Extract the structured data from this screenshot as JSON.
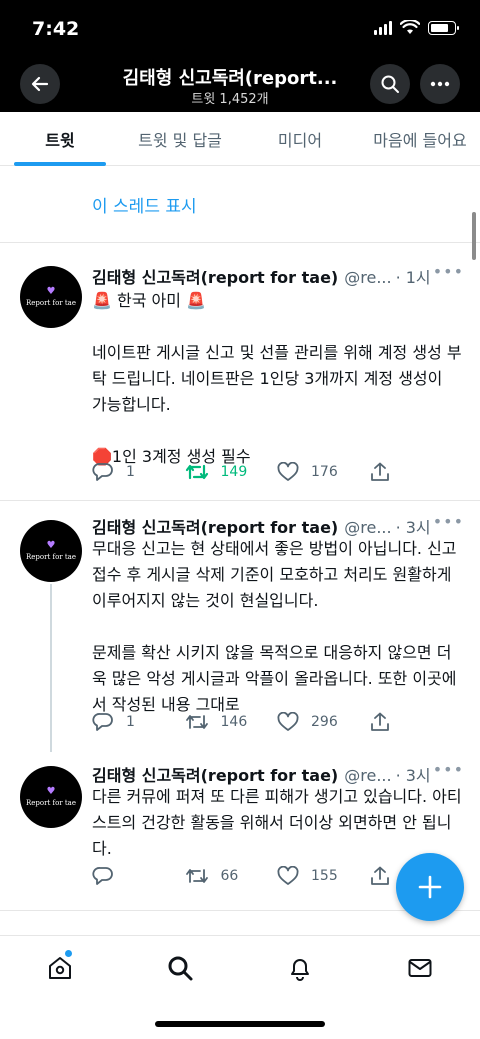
{
  "status_bar": {
    "time": "7:42"
  },
  "header": {
    "title": "김태형 신고독려(report...",
    "subtitle": "트윗 1,452개"
  },
  "tabs": [
    {
      "label": "트윗",
      "active": true
    },
    {
      "label": "트윗 및 답글",
      "active": false
    },
    {
      "label": "미디어",
      "active": false
    },
    {
      "label": "마음에 들어요",
      "active": false
    }
  ],
  "show_thread": "이 스레드 표시",
  "avatar_text": "Report for tae",
  "tweets": [
    {
      "name": "김태형 신고독려(report for tae)",
      "handle": "@re...",
      "time": "· 1시",
      "body": "🚨 한국 아미 🚨\n\n네이트판 게시글 신고 및 선플 관리를 위해 계정 생성 부탁 드립니다. 네이트판은 1인당 3개까지 계정 생성이 가능합니다.\n\n🛑1인 3계정 생성 필수",
      "replies": "1",
      "retweets": "149",
      "likes": "176"
    },
    {
      "name": "김태형 신고독려(report for tae)",
      "handle": "@re...",
      "time": "· 3시",
      "body": "무대응 신고는 현 상태에서 좋은 방법이 아닙니다. 신고접수 후 게시글 삭제 기준이 모호하고 처리도 원활하게 이루어지지 않는 것이 현실입니다.\n\n문제를 확산 시키지 않을 목적으로 대응하지 않으면 더욱 많은 악성 게시글과 악플이 올라옵니다. 또한 이곳에서 작성된 내용 그대로",
      "replies": "1",
      "retweets": "146",
      "likes": "296"
    },
    {
      "name": "김태형 신고독려(report for tae)",
      "handle": "@re...",
      "time": "· 3시",
      "body": "다른 커뮤에 퍼져 또 다른 피해가 생기고 있습니다. 아티스트의 건강한 활동을 위해서 더이상 외면하면 안 됩니다.",
      "replies": "",
      "retweets": "66",
      "likes": "155"
    }
  ],
  "colors": {
    "accent": "#1d9bf0",
    "retweet_active": "#00ba7c",
    "muted": "#536471"
  },
  "icons": [
    "back-arrow-icon",
    "search-icon",
    "more-icon",
    "reply-icon",
    "retweet-icon",
    "like-icon",
    "share-icon",
    "compose-icon",
    "home-icon",
    "explore-icon",
    "bell-icon",
    "mail-icon"
  ]
}
